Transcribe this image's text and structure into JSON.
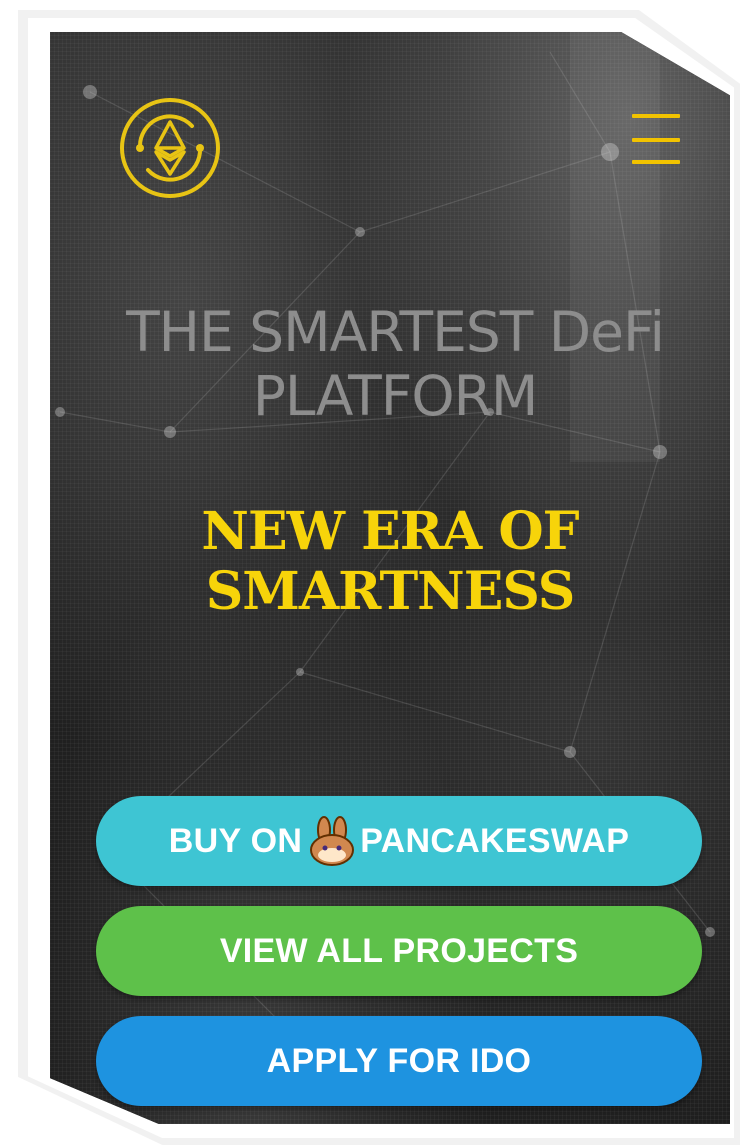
{
  "header": {
    "logo_icon": "ethereum-circle-logo-icon",
    "menu_icon": "hamburger-menu-icon"
  },
  "hero": {
    "headline": "THE SMARTEST DeFi PLATFORM",
    "tagline_line1": "NEW ERA OF",
    "tagline_line2": "SMARTNESS"
  },
  "actions": {
    "buy_prefix": "BUY ON",
    "buy_suffix": "PANCAKESWAP",
    "buy_icon": "pancakeswap-bunny-icon",
    "view_label": "VIEW ALL PROJECTS",
    "apply_label": "APPLY FOR IDO"
  },
  "colors": {
    "accent_yellow": "#f7d40a",
    "buy_button": "#3ec5d3",
    "view_button": "#5ec14a",
    "apply_button": "#1e93e0",
    "background": "#262626"
  }
}
